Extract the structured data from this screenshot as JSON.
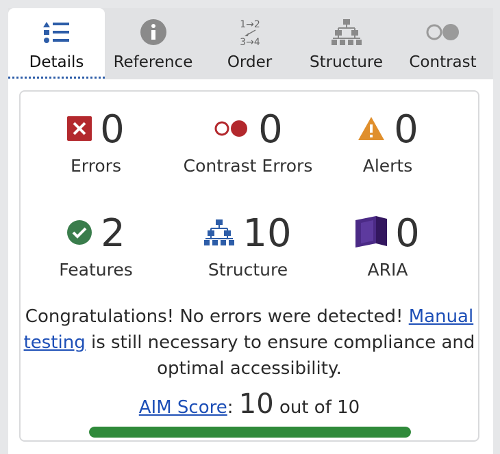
{
  "tabs": [
    {
      "label": "Details",
      "icon": "details-list-icon",
      "active": true
    },
    {
      "label": "Reference",
      "icon": "info-icon",
      "active": false
    },
    {
      "label": "Order",
      "icon": "order-icon",
      "active": false
    },
    {
      "label": "Structure",
      "icon": "structure-icon",
      "active": false
    },
    {
      "label": "Contrast",
      "icon": "contrast-icon",
      "active": false
    }
  ],
  "order_icon_text": {
    "top": "1→2",
    "bottom": "3→4"
  },
  "stats": {
    "errors": {
      "value": "0",
      "label": "Errors",
      "icon": "error-icon"
    },
    "contrast_errors": {
      "value": "0",
      "label": "Contrast Errors",
      "icon": "contrast-error-icon"
    },
    "alerts": {
      "value": "0",
      "label": "Alerts",
      "icon": "alert-icon"
    },
    "features": {
      "value": "2",
      "label": "Features",
      "icon": "feature-check-icon"
    },
    "structure": {
      "value": "10",
      "label": "Structure",
      "icon": "structure-icon"
    },
    "aria": {
      "value": "0",
      "label": "ARIA",
      "icon": "aria-icon"
    }
  },
  "message": {
    "intro": "Congratulations! No errors were detected! ",
    "link": "Manual testing",
    "rest": " is still necessary to ensure compliance and optimal accessibility."
  },
  "score": {
    "link": "AIM Score",
    "separator": ": ",
    "value": "10",
    "suffix": " out of 10",
    "fraction": 1.0
  },
  "colors": {
    "accent": "#2d5da8",
    "error": "#b3282d",
    "alert": "#e08f2c",
    "feature": "#3a7d4c",
    "aria": "#4b2a86",
    "progress": "#2f8a3a",
    "link": "#1d4fb7"
  }
}
